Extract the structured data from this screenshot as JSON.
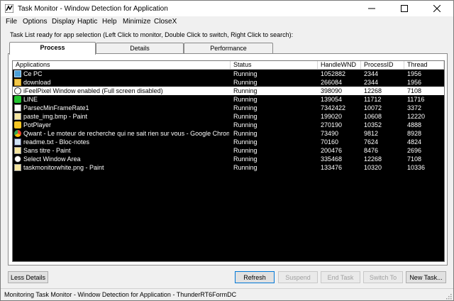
{
  "window": {
    "title": "Task Monitor - Window Detection for Application"
  },
  "menu": [
    {
      "label": "File"
    },
    {
      "label": "Options"
    },
    {
      "label": "Display"
    },
    {
      "label": "Haptic"
    },
    {
      "label": "Help"
    },
    {
      "label": "Minimize"
    },
    {
      "label": "CloseX"
    }
  ],
  "hint": "Task List ready for app selection (Left Click to monitor, Double Click to switch, Right Click to search):",
  "tabs": [
    {
      "label": "Process"
    },
    {
      "label": "Details"
    },
    {
      "label": "Performance"
    }
  ],
  "columns": {
    "app": "Applications",
    "status": "Status",
    "handle": "HandleWND",
    "pid": "ProcessID",
    "thread": "Thread"
  },
  "rows": [
    {
      "icon": "computer-icon",
      "app": "Ce PC",
      "status": "Running",
      "handle": "1052882",
      "pid": "2344",
      "thread": "1956"
    },
    {
      "icon": "folder-icon",
      "app": "download",
      "status": "Running",
      "handle": "266084",
      "pid": "2344",
      "thread": "1956"
    },
    {
      "icon": "eye-icon",
      "app": "iFeelPixel Window enabled (Full screen disabled)",
      "status": "Running",
      "handle": "398090",
      "pid": "12268",
      "thread": "7108",
      "selected": true
    },
    {
      "icon": "line-app-icon",
      "app": "LINE",
      "status": "Running",
      "handle": "139054",
      "pid": "11712",
      "thread": "11716"
    },
    {
      "icon": "parsec-icon",
      "app": "ParsecMinFrameRate1",
      "status": "Running",
      "handle": "7342422",
      "pid": "10072",
      "thread": "3372"
    },
    {
      "icon": "paint-icon",
      "app": "paste_img.bmp - Paint",
      "status": "Running",
      "handle": "199020",
      "pid": "10608",
      "thread": "12220"
    },
    {
      "icon": "potplayer-icon",
      "app": "PotPlayer",
      "status": "Running",
      "handle": "270190",
      "pid": "10352",
      "thread": "4888"
    },
    {
      "icon": "chrome-icon",
      "app": "Qwant - Le moteur de recherche qui ne sait rien sur vous - Google Chrome",
      "status": "Running",
      "handle": "73490",
      "pid": "9812",
      "thread": "8928"
    },
    {
      "icon": "notepad-icon",
      "app": "readme.txt - Bloc-notes",
      "status": "Running",
      "handle": "70160",
      "pid": "7624",
      "thread": "4824"
    },
    {
      "icon": "paint-icon",
      "app": "Sans titre - Paint",
      "status": "Running",
      "handle": "200476",
      "pid": "8476",
      "thread": "2696"
    },
    {
      "icon": "eye-icon",
      "app": "Select Window Area",
      "status": "Running",
      "handle": "335468",
      "pid": "12268",
      "thread": "7108"
    },
    {
      "icon": "paint-icon",
      "app": "taskmonitorwhite.png - Paint",
      "status": "Running",
      "handle": "133476",
      "pid": "10320",
      "thread": "10336"
    }
  ],
  "buttons": {
    "less_details": "Less Details",
    "refresh": "Refresh",
    "suspend": "Suspend",
    "end_task": "End Task",
    "switch_to": "Switch To",
    "new_task": "New Task..."
  },
  "status": "Monitoring Task Monitor - Window Detection for Application - ThunderRT6FormDC",
  "colors": {
    "list_bg": "#000000",
    "list_text": "#ffffff",
    "selected_bg": "#ffffff",
    "focus_border": "#0078d7"
  }
}
